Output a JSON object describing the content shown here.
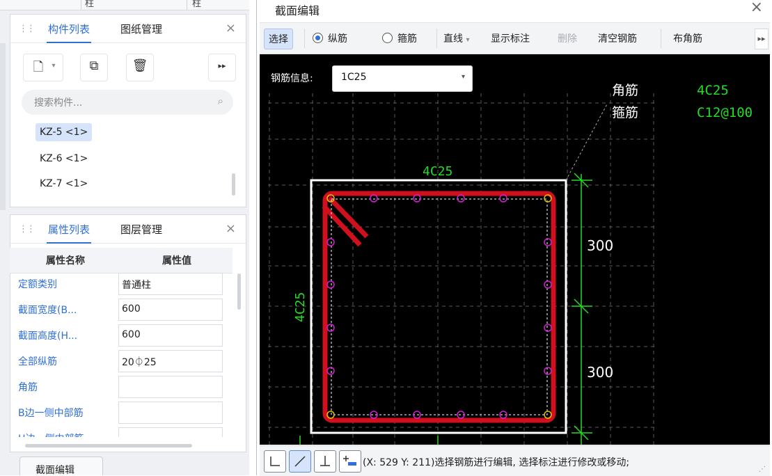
{
  "left_panel": {
    "top_strip": {
      "col1": "柱",
      "col2": "柱"
    },
    "component_panel": {
      "tabs": [
        "构件列表",
        "图纸管理"
      ],
      "close": "×",
      "search_placeholder": "搜索构件...",
      "components": [
        "KZ-5 <1>",
        "KZ-6 <1>",
        "KZ-7 <1>"
      ],
      "selected_index": 0
    },
    "property_panel": {
      "tabs": [
        "属性列表",
        "图层管理"
      ],
      "close": "×",
      "headers": [
        "属性名称",
        "属性值"
      ],
      "rows": [
        {
          "name": "定额类别",
          "value": "普通柱"
        },
        {
          "name": "截面宽度(B...",
          "value": "600"
        },
        {
          "name": "截面高度(H...",
          "value": "600"
        },
        {
          "name": "全部纵筋",
          "value": "20⏀25"
        },
        {
          "name": "角筋",
          "value": ""
        },
        {
          "name": "B边一侧中部筋",
          "value": ""
        },
        {
          "name": "H边一侧中部筋",
          "value": ""
        }
      ]
    },
    "bottom_button": "截面编辑"
  },
  "dialog": {
    "title": "截面编辑",
    "close": "×",
    "toolbar": {
      "select": "选择",
      "longitudinal": "纵筋",
      "stirrup": "箍筋",
      "line_mode": "直线",
      "show_dims": "显示标注",
      "delete": "删除",
      "clear": "清空钢筋",
      "corner": "布角筋",
      "more": "▸▸"
    },
    "rebar_info_label": "钢筋信息:",
    "rebar_info_value": "1C25",
    "canvas": {
      "callout_corner_label": "角筋",
      "callout_corner_value": "4C25",
      "callout_stirrup_label": "箍筋",
      "callout_stirrup_value": "C12@100",
      "top_label": "4C25",
      "left_label": "4C25",
      "dim_upper": "300",
      "dim_lower": "300"
    },
    "status_text": "(X: 529 Y: 211)选择钢筋进行编辑, 选择标注进行修改或移动;"
  },
  "colors": {
    "accent": "#2f6fd6",
    "rebar_red": "#d0101c",
    "rebar_magenta": "#d020d0",
    "corner_yellow": "#e0c000",
    "cad_green": "#22dd22",
    "cad_bg": "#000000"
  }
}
